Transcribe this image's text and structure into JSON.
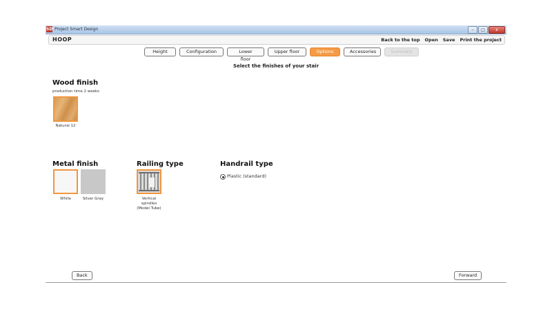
{
  "window": {
    "title": "Project Smart Design",
    "app_icon_text": "SD",
    "controls": {
      "minimize": "–",
      "maximize": "□",
      "close": "x"
    }
  },
  "toolbar": {
    "logo": "HOOP",
    "links": [
      "Back to the top",
      "Open",
      "Save",
      "Print the project"
    ]
  },
  "tabs": [
    {
      "label": "Height",
      "state": "normal"
    },
    {
      "label": "Configuration",
      "state": "normal"
    },
    {
      "label": "Lower floor",
      "state": "normal"
    },
    {
      "label": "Upper floor",
      "state": "normal"
    },
    {
      "label": "Options",
      "state": "active"
    },
    {
      "label": "Accessories",
      "state": "normal"
    },
    {
      "label": "Summary",
      "state": "disabled"
    }
  ],
  "main": {
    "heading": "Select the finishes of your stair",
    "wood": {
      "title": "Wood finish",
      "note": "production time 2 weeks",
      "options": [
        {
          "label": "Natural 12",
          "selected": true
        }
      ]
    },
    "metal": {
      "title": "Metal finish",
      "options": [
        {
          "label": "White",
          "selected": true,
          "color": "#f7f7f7"
        },
        {
          "label": "Silver Gray",
          "selected": false,
          "color": "#c8c8c8"
        }
      ]
    },
    "railing": {
      "title": "Railing type",
      "options": [
        {
          "label_lines": [
            "Vertical",
            "spindles",
            "(Model Tube)"
          ],
          "selected": true
        }
      ]
    },
    "handrail": {
      "title": "Handrail type",
      "options": [
        {
          "label": "Plastic (standard)",
          "selected": true
        }
      ]
    }
  },
  "footer": {
    "back": "Back",
    "forward": "Forward"
  },
  "colors": {
    "accent": "#f59a45",
    "selected_border": "#f0963c"
  }
}
